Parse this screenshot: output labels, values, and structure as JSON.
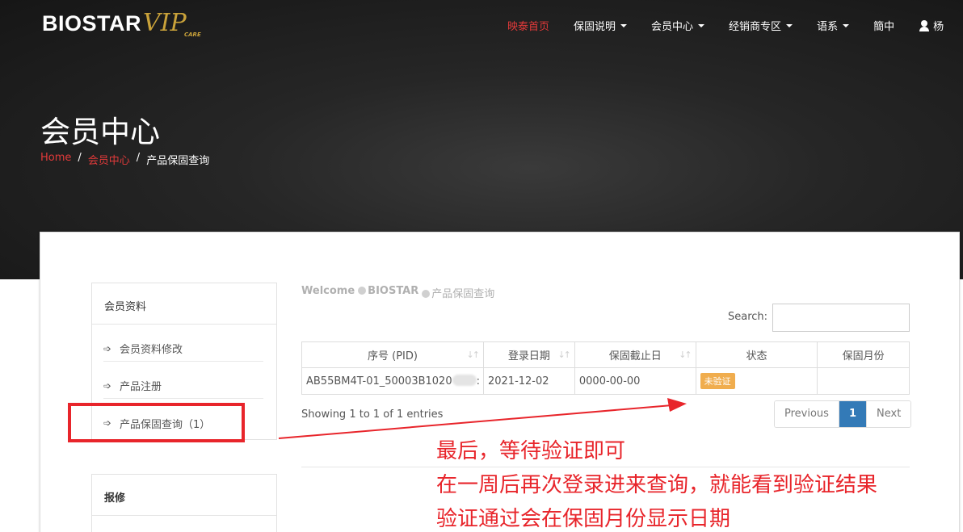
{
  "brand": {
    "logo_text": "BIOSTAR",
    "logo_vip": "VIP",
    "logo_care": "CARE"
  },
  "nav": {
    "items": [
      {
        "label": "映泰首页",
        "active": true,
        "dropdown": false
      },
      {
        "label": "保固说明",
        "active": false,
        "dropdown": true
      },
      {
        "label": "会员中心",
        "active": false,
        "dropdown": true
      },
      {
        "label": "经销商专区",
        "active": false,
        "dropdown": true
      },
      {
        "label": "语系",
        "active": false,
        "dropdown": true
      },
      {
        "label": "簡中",
        "active": false,
        "dropdown": false
      }
    ],
    "user_label": "杨"
  },
  "hero": {
    "title": "会员中心",
    "breadcrumb": [
      "Home",
      "会员中心",
      "产品保固查询"
    ]
  },
  "sidebar": {
    "panel1": {
      "title": "会员资料",
      "items": [
        {
          "label": "会员资料修改"
        },
        {
          "label": "产品注册"
        },
        {
          "label": "产品保固查询（1）"
        }
      ]
    },
    "panel2": {
      "title": "报修"
    }
  },
  "welcome": {
    "prefix": "Welcome",
    "brand": "BIOSTAR",
    "page": "产品保固查询"
  },
  "search": {
    "label": "Search:",
    "value": ""
  },
  "table": {
    "headers": [
      "序号 (PID)",
      "登录日期",
      "保固截止日",
      "状态",
      "保固月份"
    ],
    "rows": [
      {
        "pid": "AB55BM4T-01_50003B1020",
        "pid_tail": ":",
        "date": "2021-12-02",
        "expire": "0000-00-00",
        "status": "未验证",
        "months": ""
      }
    ]
  },
  "info": "Showing 1 to 1 of 1 entries",
  "pagination": {
    "prev": "Previous",
    "current": "1",
    "next": "Next"
  },
  "annotation": {
    "lines": [
      "最后，等待验证即可",
      "在一周后再次登录进来查询，就能看到验证结果",
      "验证通过会在保固月份显示日期"
    ],
    "color": "#e8252b"
  },
  "colors": {
    "accent_red": "#e23a3a",
    "pager_blue": "#337ab7",
    "badge_orange": "#f0ad4e"
  }
}
